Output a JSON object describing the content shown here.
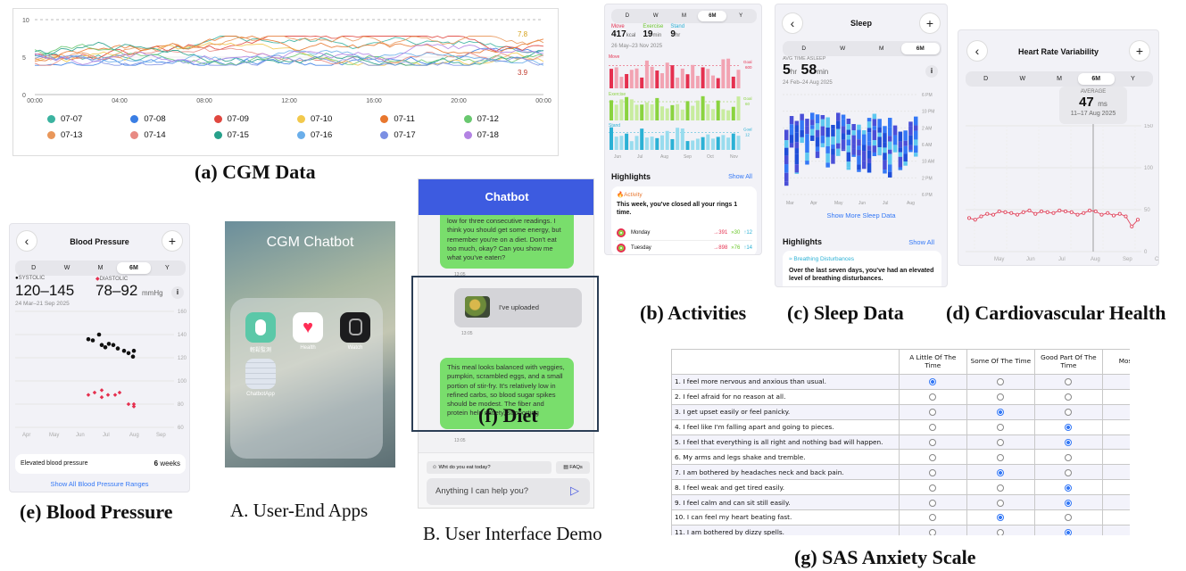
{
  "captions": {
    "cgm": "(a) CGM Data",
    "activities": "(b) Activities",
    "sleep": "(c) Sleep Data",
    "cardio": "(d) Cardiovascular Health",
    "bp": "(e) Blood Pressure",
    "apps": "A. User-End Apps",
    "demo": "B. User Interface Demo",
    "diet": "(f) Diet",
    "sas": "(g) SAS Anxiety Scale"
  },
  "cgm": {
    "y_ticks": [
      "10",
      "5",
      "0"
    ],
    "x_ticks": [
      "00:00",
      "04:00",
      "08:00",
      "12:00",
      "16:00",
      "20:00",
      "00:00"
    ],
    "max_label": "7.8",
    "min_label": "3.9",
    "legend": [
      {
        "name": "07-07",
        "color": "#3bb3a0"
      },
      {
        "name": "07-08",
        "color": "#3a7ee4"
      },
      {
        "name": "07-09",
        "color": "#e0473f"
      },
      {
        "name": "07-10",
        "color": "#f2c94c"
      },
      {
        "name": "07-11",
        "color": "#e8772e"
      },
      {
        "name": "07-12",
        "color": "#69c86f"
      },
      {
        "name": "07-13",
        "color": "#e9975a"
      },
      {
        "name": "07-14",
        "color": "#e88a83"
      },
      {
        "name": "07-15",
        "color": "#27a08a"
      },
      {
        "name": "07-16",
        "color": "#6aaeea"
      },
      {
        "name": "07-17",
        "color": "#7b8fe3"
      },
      {
        "name": "07-18",
        "color": "#b383e3"
      }
    ]
  },
  "activities": {
    "segments": [
      "D",
      "W",
      "M",
      "6M",
      "Y"
    ],
    "active_segment": "6M",
    "move_label": "Move",
    "move_value": "417",
    "move_unit": "kcal",
    "exercise_label": "Exercise",
    "exercise_value": "19",
    "exercise_unit": "min",
    "stand_label": "Stand",
    "stand_value": "9",
    "stand_unit": "hr",
    "date_range": "26 May–23 Nov 2025",
    "goal_label": "Goal",
    "move_goal": "600",
    "exercise_goal": "60",
    "stand_goal": "12",
    "months": [
      "Jun",
      "Jul",
      "Aug",
      "Sep",
      "Oct",
      "Nov"
    ],
    "highlights_title": "Highlights",
    "show_all": "Show All",
    "activity_tag": "Activity",
    "highlight_text": "This week, you've closed all your rings 1 time.",
    "rows": [
      {
        "day": "Monday",
        "move": "391",
        "exercise": "30",
        "stand": "12"
      },
      {
        "day": "Tuesday",
        "move": "898",
        "exercise": "76",
        "stand": "14"
      }
    ]
  },
  "sleep": {
    "title": "Sleep",
    "segments": [
      "D",
      "W",
      "M",
      "6M"
    ],
    "active_segment": "6M",
    "avg_label": "AVG TIME ASLEEP",
    "hours": "5",
    "hr_unit": "hr",
    "minutes": "58",
    "min_unit": "min",
    "date_range": "24 Feb–24 Aug 2025",
    "y_ticks": [
      "6 PM",
      "10 PM",
      "2 AM",
      "6 AM",
      "10 AM",
      "2 PM",
      "6 PM"
    ],
    "months": [
      "Mar",
      "Apr",
      "May",
      "Jun",
      "Jul",
      "Aug"
    ],
    "show_more": "Show More Sleep Data",
    "highlights_title": "Highlights",
    "show_all": "Show All",
    "tag": "Breathing Disturbances",
    "highlight_text": "Over the last seven days, you've had an elevated level of breathing disturbances."
  },
  "hrv": {
    "title": "Heart Rate Variability",
    "segments": [
      "D",
      "W",
      "M",
      "6M",
      "Y"
    ],
    "active_segment": "6M",
    "avg_label": "AVERAGE",
    "value": "47",
    "unit": "ms",
    "date_range": "11–17 Aug 2025",
    "y_ticks": [
      "150",
      "100",
      "50",
      "0"
    ],
    "months": [
      "May",
      "Jun",
      "Jul",
      "Aug",
      "Sep",
      "C"
    ],
    "values": [
      40,
      38,
      42,
      45,
      44,
      48,
      47,
      46,
      44,
      47,
      49,
      45,
      48,
      47,
      46,
      49,
      48,
      47,
      44,
      46,
      49,
      48,
      44,
      46,
      43,
      45,
      42,
      30,
      38
    ]
  },
  "bp": {
    "title": "Blood Pressure",
    "segments": [
      "D",
      "W",
      "M",
      "6M",
      "Y"
    ],
    "active_segment": "6M",
    "sys_label": "SYSTOLIC",
    "dia_label": "DIASTOLIC",
    "sys_value": "120–145",
    "dia_value": "78–92",
    "unit": "mmHg",
    "date_range": "24 Mar–21 Sep 2025",
    "y_ticks": [
      "160",
      "140",
      "120",
      "100",
      "80",
      "60"
    ],
    "months": [
      "Apr",
      "May",
      "Jun",
      "Jul",
      "Aug",
      "Sep"
    ],
    "elevated_label": "Elevated blood pressure",
    "weeks_value": "6",
    "weeks_unit": "weeks",
    "show_all": "Show All Blood Pressure Ranges"
  },
  "apps": {
    "title": "CGM Chatbot",
    "icons": [
      {
        "name": "輕鬆監測",
        "color": "#5bc8a8"
      },
      {
        "name": "Health",
        "color": "#ffffff"
      },
      {
        "name": "Watch",
        "color": "#1c1c1e"
      },
      {
        "name": "ChatbotApp",
        "color": "#dfe5ee"
      }
    ]
  },
  "chat": {
    "title": "Chatbot",
    "msg1": "low for three consecutive readings. I think you should get some energy, but remember you're on a diet. Don't eat too much, okay? Can you show me what you've eaten?",
    "time1": "13:05",
    "upload": "I've uploaded",
    "time2": "13:05",
    "msg2": "This meal looks balanced with veggies, pumpkin, scrambled eggs, and a small portion of stir-fry. It's relatively low in refined carbs, so blood sugar spikes should be modest. The fiber and protein help satiety, supporting",
    "time3": "13:05",
    "chip1": "Wht do you eat today?",
    "chip2": "FAQs",
    "input_placeholder": "Anything I can help you?"
  },
  "sas": {
    "headers": [
      "",
      "A Little Of The Time",
      "Some Of The Time",
      "Good Part Of The Time",
      "Most Of Th"
    ],
    "rows": [
      {
        "q": "1. I feel more nervous and anxious than usual.",
        "sel": 0
      },
      {
        "q": "2. I feel afraid for no reason at all.",
        "sel": -1
      },
      {
        "q": "3. I get upset easily or feel panicky.",
        "sel": 1
      },
      {
        "q": "4. I feel like I'm falling apart and going to pieces.",
        "sel": 2
      },
      {
        "q": "5. I feel that everything is all right and nothing bad will happen.",
        "sel": 2
      },
      {
        "q": "6. My arms and legs shake and tremble.",
        "sel": -1
      },
      {
        "q": "7. I am bothered by headaches neck and back pain.",
        "sel": 1
      },
      {
        "q": "8. I feel weak and get tired easily.",
        "sel": 2
      },
      {
        "q": "9. I feel calm and can sit still easily.",
        "sel": 2
      },
      {
        "q": "10. I can feel my heart beating fast.",
        "sel": 1
      },
      {
        "q": "11. I am bothered by dizzy spells.",
        "sel": 2
      }
    ]
  }
}
